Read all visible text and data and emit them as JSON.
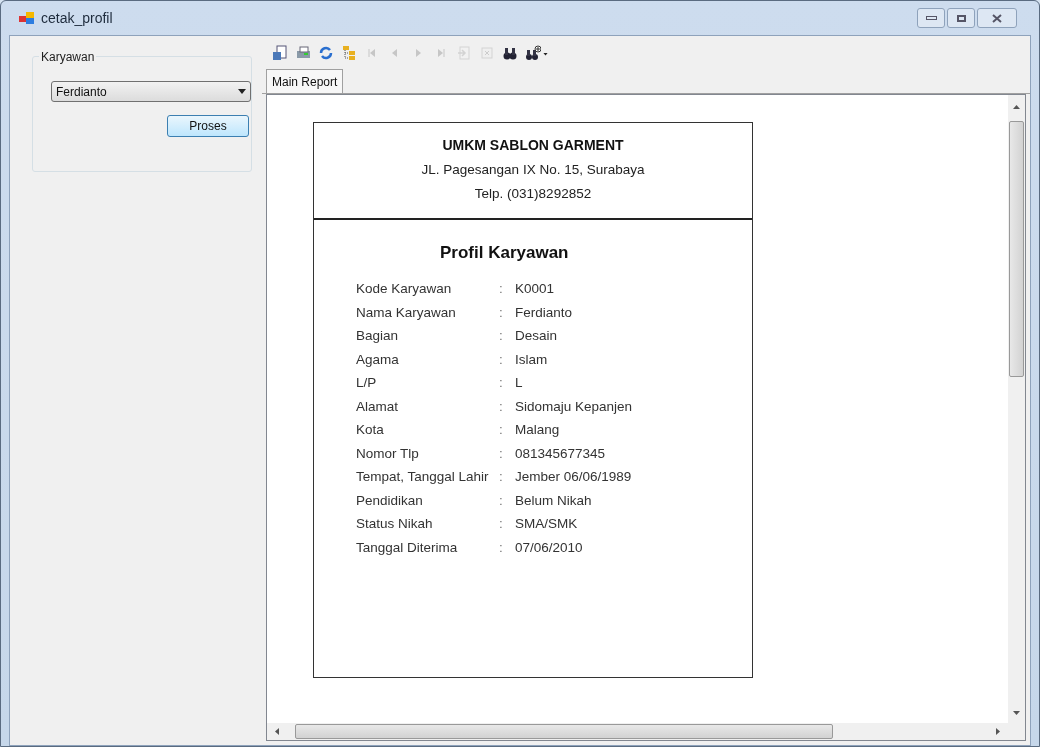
{
  "window": {
    "title": "cetak_profil"
  },
  "group": {
    "title": "Karyawan",
    "dropdown_value": "Ferdianto",
    "button": "Proses"
  },
  "toolbar": [
    {
      "kind": "export",
      "disabled": false
    },
    {
      "kind": "print",
      "disabled": false
    },
    {
      "kind": "refresh",
      "disabled": false
    },
    {
      "kind": "tree",
      "disabled": false
    },
    {
      "kind": "first",
      "disabled": true
    },
    {
      "kind": "prev",
      "disabled": true
    },
    {
      "kind": "next",
      "disabled": true
    },
    {
      "kind": "last",
      "disabled": true
    },
    {
      "kind": "goto",
      "disabled": true
    },
    {
      "kind": "stop",
      "disabled": true
    },
    {
      "kind": "search",
      "disabled": false
    },
    {
      "kind": "zoom",
      "disabled": false
    }
  ],
  "tabs": [
    {
      "label": "Main Report",
      "selected": true
    }
  ],
  "report": {
    "company": "UMKM SABLON GARMENT",
    "address": "JL. Pagesangan IX No. 15, Surabaya",
    "phone": "Telp. (031)8292852",
    "title": "Profil Karyawan",
    "rows": [
      {
        "label": "Kode Karyawan",
        "separator": ":",
        "value": "K0001"
      },
      {
        "label": "Nama Karyawan",
        "separator": ":",
        "value": "Ferdianto"
      },
      {
        "label": "Bagian",
        "separator": ":",
        "value": "Desain"
      },
      {
        "label": "Agama",
        "separator": ":",
        "value": "Islam"
      },
      {
        "label": "L/P",
        "separator": ":",
        "value": "L"
      },
      {
        "label": "Alamat",
        "separator": ":",
        "value": "Sidomaju Kepanjen"
      },
      {
        "label": "Kota",
        "separator": ":",
        "value": "Malang"
      },
      {
        "label": "Nomor Tlp",
        "separator": ":",
        "value": "081345677345"
      },
      {
        "label": "Tempat, Tanggal Lahir",
        "separator": ":",
        "value": "Jember 06/06/1989"
      },
      {
        "label": "Pendidikan",
        "separator": ":",
        "value": "Belum Nikah"
      },
      {
        "label": "Status Nikah",
        "separator": ":",
        "value": "SMA/SMK"
      },
      {
        "label": "Tanggal Diterima",
        "separator": ":",
        "value": "07/06/2010"
      }
    ]
  }
}
